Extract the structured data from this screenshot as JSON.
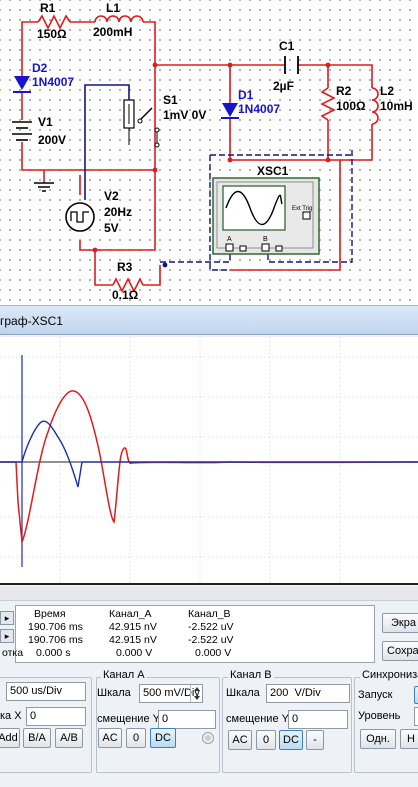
{
  "schematic": {
    "components": {
      "r1": {
        "ref": "R1",
        "value": "150Ω"
      },
      "l1": {
        "ref": "L1",
        "value": "200mH"
      },
      "d2": {
        "ref": "D2",
        "model": "1N4007"
      },
      "v1": {
        "ref": "V1",
        "value": "200V"
      },
      "c1": {
        "ref": "C1",
        "value": "2µF"
      },
      "s1": {
        "ref": "S1",
        "value": "1mV 0V"
      },
      "d1": {
        "ref": "D1",
        "model": "1N4007"
      },
      "r2": {
        "ref": "R2",
        "value": "100Ω"
      },
      "l2": {
        "ref": "L2",
        "value": "10mH"
      },
      "v2": {
        "ref": "V2",
        "freq": "20Hz",
        "amp": "5V"
      },
      "r3": {
        "ref": "R3",
        "value": "0.1Ω"
      },
      "xsc1": {
        "ref": "XSC1",
        "ext_trig": "Ext Trig",
        "ch_a": "A",
        "ch_b": "B"
      }
    },
    "colors": {
      "wire": "#e01b1b",
      "probe": "#12167a",
      "diode": "#1515d0"
    }
  },
  "window": {
    "title": "граф-XSC1"
  },
  "scope": {
    "colors": {
      "channel_a": "#e01b1b",
      "channel_b": "#1a2fa8"
    }
  },
  "readout": {
    "headers": {
      "time": "Время",
      "ch_a": "Канал_A",
      "ch_b": "Канал_B"
    },
    "rows": [
      {
        "label": "",
        "time": "190.706 ms",
        "ch_a": "42.915 nV",
        "ch_b": "-2.522 uV"
      },
      {
        "label": "",
        "time": "190.706 ms",
        "ch_a": "42.915 nV",
        "ch_b": "-2.522 uV"
      },
      {
        "label": "отка",
        "time": "0.000 s",
        "ch_a": "0.000 V",
        "ch_b": "0.000 V"
      }
    ],
    "side_buttons": {
      "invert": "Экра",
      "save": "Сохра"
    }
  },
  "controls": {
    "timebase": {
      "title": "",
      "scale_value": "500 us/Div",
      "xpos_label": "ка X",
      "xpos_value": "0",
      "buttons": [
        "Add",
        "B/A",
        "A/B"
      ]
    },
    "channel_a": {
      "title": "Канал A",
      "scale_label": "Шкала",
      "scale_value": "500 mV/Div",
      "offset_label": "смещение Y",
      "offset_value": "0",
      "coupling": [
        "AC",
        "0",
        "DC"
      ],
      "coupling_selected": "DC"
    },
    "channel_b": {
      "title": "Канал B",
      "scale_label": "Шкала",
      "scale_value": "200  V/Div",
      "offset_label": "смещение Y",
      "offset_value": "0",
      "coupling": [
        "AC",
        "0",
        "DC",
        "-"
      ],
      "coupling_selected": "DC"
    },
    "trigger": {
      "title": "Синхрониза",
      "edge_label": "Запуск",
      "level_label": "Уровень",
      "buttons": [
        "Одн.",
        "Н"
      ]
    }
  }
}
